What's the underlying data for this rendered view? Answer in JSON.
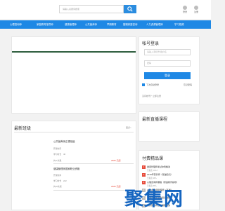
{
  "header": {
    "search_placeholder": "请输入关键词搜索",
    "user_links": [
      "登录",
      "注册"
    ]
  },
  "nav": {
    "items": [
      "心理咨询师",
      "家庭教育指导师",
      "健康管理师",
      "公共营养师",
      "早期教育",
      "婚姻家庭咨询",
      "人力资源管理师",
      "学习视频"
    ]
  },
  "login": {
    "title": "帐号登录",
    "username_placeholder": "请输入手机号/用户名",
    "password_placeholder": "密码",
    "submit_label": "登录",
    "remember_label": "下次自动登录",
    "forgot_label": "忘记密码",
    "register_hint": "没有帐号？立即注册"
  },
  "classes": {
    "title": "最新班级",
    "more_label": "更多>",
    "items": [
      {
        "title": "公共营养师正课班级",
        "meta1": "开课时间",
        "meta2": "学习时长",
        "meta3": "46",
        "meta4": "共11次课",
        "price": "2580 元起"
      },
      {
        "title": "健康管理师国家职业资格",
        "meta1": "开课时间",
        "meta2": "学习时长",
        "meta3": "242",
        "meta4": "共30次课",
        "price": "2580 元起"
      }
    ]
  },
  "live": {
    "title": "最新直播课程"
  },
  "ranking": {
    "title": "付费精品课",
    "items": [
      {
        "num": "1",
        "text": "健康管理师考试冲刺精讲",
        "sub": "已报名 103人"
      },
      {
        "num": "2",
        "text": "2019年营养师（基础知识）",
        "sub": "已报名 98人"
      },
      {
        "num": "3",
        "text": "心理咨询师课程（家庭教育指导）",
        "sub": "已报名 85人"
      },
      {
        "num": "4",
        "text": "2019年健康管理师（基础）",
        "sub": "已报名 71人"
      },
      {
        "num": "5",
        "text": "育婴员职业资格培训课程",
        "sub": "已报名 66人"
      },
      {
        "num": "6",
        "text": "公共营养师三级课程精讲",
        "sub": "已报名 58人"
      }
    ]
  },
  "colors": {
    "primary": "#1e88e5",
    "rank_top": "#e74c3c",
    "rank_other": "#bdbdbd"
  }
}
